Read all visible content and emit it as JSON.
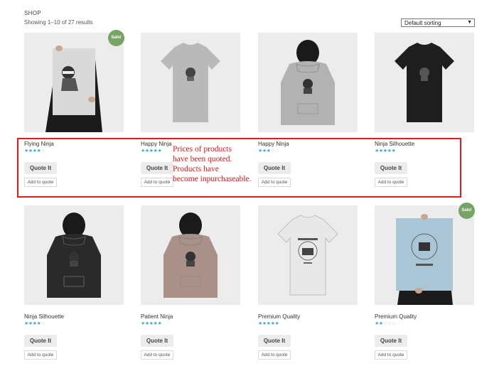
{
  "shop": {
    "title": "SHOP",
    "result_count": "Showing 1–10 of 27 results",
    "sorting": "Default sorting",
    "sorting_arrow": "▼"
  },
  "products": [
    {
      "name": "Flying Ninja",
      "rating": 4,
      "image": "poster-ninja-image",
      "sale": true
    },
    {
      "name": "Happy Ninja",
      "rating": 5,
      "image": "tshirt-grey-image",
      "sale": false
    },
    {
      "name": "Happy Ninja",
      "rating": 3,
      "image": "hoodie-grey-image",
      "sale": false
    },
    {
      "name": "Ninja Silhouette",
      "rating": 5,
      "image": "tshirt-black-image",
      "sale": false
    },
    {
      "name": "Ninja Silhouette",
      "rating": 4,
      "image": "hoodie-black-image",
      "sale": false
    },
    {
      "name": "Patient Ninja",
      "rating": 5,
      "image": "hoodie-pink-image",
      "sale": false
    },
    {
      "name": "Premium Quality",
      "rating": 4.5,
      "image": "tshirt-white-logo-image",
      "sale": false
    },
    {
      "name": "Premium Quality",
      "rating": 2,
      "image": "poster-woothemes-image",
      "sale": true
    }
  ],
  "labels": {
    "quote_button": "Quote It",
    "add_to_quote": "Add to quote",
    "sale_badge": "Sale!"
  },
  "annotation": {
    "text": "Prices of products\nhave been quoted.\nProducts have\nbecome inpurchaseable."
  },
  "colors": {
    "star": "#3fa7d6",
    "star_off": "#c9c9c9",
    "sale": "#77a464",
    "highlight": "#e01c1c"
  }
}
